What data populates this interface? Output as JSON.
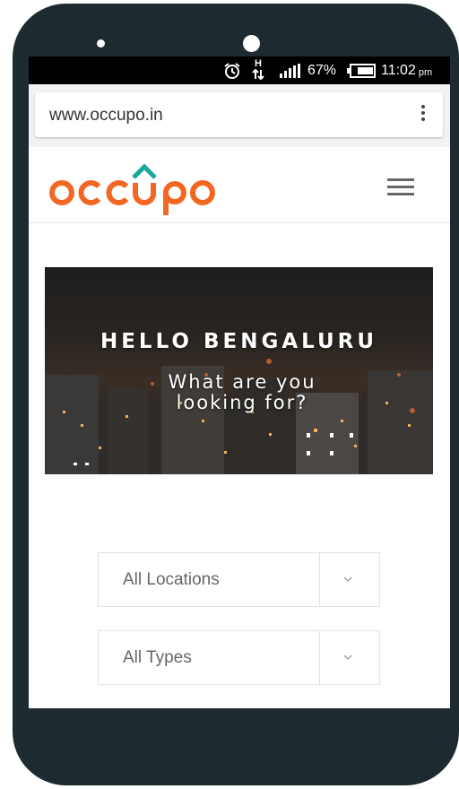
{
  "status_bar": {
    "battery": "67%",
    "time": "11:02",
    "time_suffix": "pm",
    "network": "H",
    "icons": [
      "alarm-icon",
      "network-arrows-icon",
      "signal-icon",
      "battery-icon"
    ]
  },
  "browser": {
    "url": "www.occupo.in",
    "menu_icon": "more-vertical-icon"
  },
  "site": {
    "logo_text": "occupo",
    "menu_icon": "hamburger-icon",
    "brand_colors": {
      "orange": "#f26722",
      "green": "#17a79b"
    }
  },
  "hero": {
    "title": "HELLO BENGALURU",
    "subtitle_line1": "What are you",
    "subtitle_line2": "looking for?"
  },
  "filters": {
    "location": {
      "selected": "All Locations",
      "icon": "chevron-down-icon"
    },
    "type": {
      "selected": "All Types",
      "icon": "chevron-down-icon"
    }
  }
}
